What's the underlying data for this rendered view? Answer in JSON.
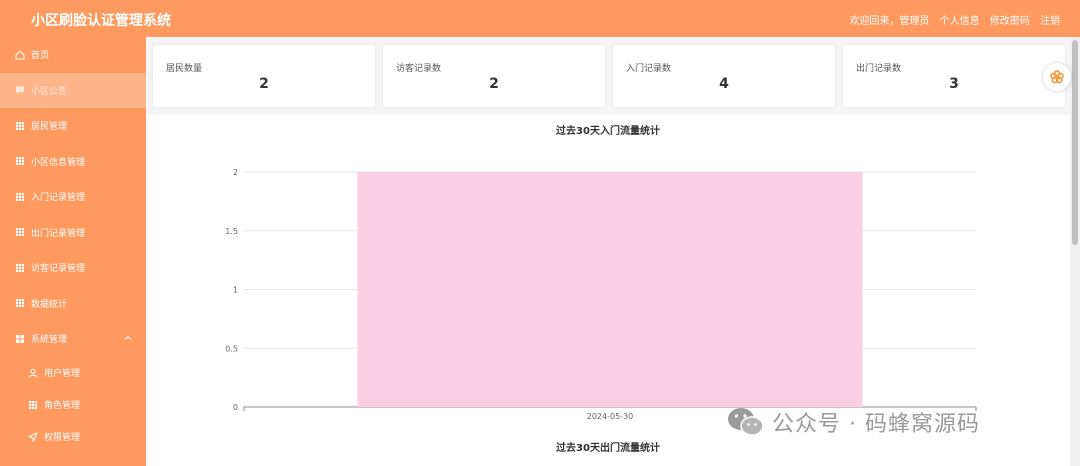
{
  "header": {
    "app_title": "小区刷脸认证管理系统",
    "welcome": "欢迎回来，管理员",
    "profile_link": "个人信息",
    "change_password_link": "修改密码",
    "logout_link": "注销"
  },
  "sidebar": {
    "items": [
      {
        "label": "首页",
        "icon": "home-icon"
      },
      {
        "label": "小区公告",
        "icon": "message-icon",
        "active": true
      },
      {
        "label": "居民管理",
        "icon": "grid-icon"
      },
      {
        "label": "小区信息管理",
        "icon": "grid-icon"
      },
      {
        "label": "入门记录管理",
        "icon": "grid-icon"
      },
      {
        "label": "出门记录管理",
        "icon": "grid-icon"
      },
      {
        "label": "访客记录管理",
        "icon": "grid-icon"
      },
      {
        "label": "数据统计",
        "icon": "grid-icon"
      },
      {
        "label": "系统管理",
        "icon": "apps-icon",
        "expanded": true
      }
    ],
    "sub_items": [
      {
        "label": "用户管理",
        "icon": "user-icon"
      },
      {
        "label": "角色管理",
        "icon": "grid-icon"
      },
      {
        "label": "权限管理",
        "icon": "send-icon"
      }
    ]
  },
  "stats": {
    "cards": [
      {
        "label": "居民数量",
        "value": "2"
      },
      {
        "label": "访客记录数",
        "value": "2"
      },
      {
        "label": "入门记录数",
        "value": "4"
      },
      {
        "label": "出门记录数",
        "value": "3"
      }
    ]
  },
  "chart_data": [
    {
      "type": "bar",
      "title": "过去30天入门流量统计",
      "categories": [
        "2024-05-30"
      ],
      "values": [
        2
      ],
      "ylim": [
        0,
        2
      ],
      "yticks": [
        "0",
        "0.5",
        "1",
        "1.5",
        "2"
      ],
      "grid": true,
      "bar_color": "#fbcfe3"
    },
    {
      "type": "bar",
      "title": "过去30天出门流量统计"
    }
  ],
  "watermark": {
    "text": "公众号 · 码蜂窝源码",
    "icon": "wechat-icon"
  },
  "colors": {
    "brand": "#fe9a5f",
    "sidebar_active": "#ffb58a"
  }
}
